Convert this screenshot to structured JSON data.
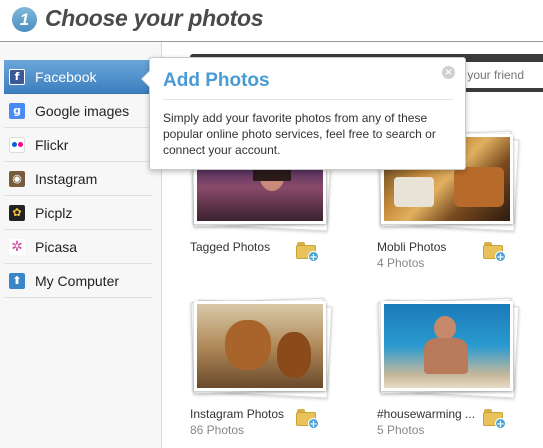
{
  "header": {
    "step_number": "1",
    "title": "Choose your photos"
  },
  "sidebar": {
    "items": [
      {
        "label": "Facebook",
        "icon": "facebook-icon",
        "color": "#3b5998",
        "glyph": "f",
        "active": true
      },
      {
        "label": "Google images",
        "icon": "google-icon",
        "color": "#4a8af4",
        "glyph": "g",
        "active": false
      },
      {
        "label": "Flickr",
        "icon": "flickr-icon",
        "color": "#ffffff",
        "glyph": "••",
        "active": false
      },
      {
        "label": "Instagram",
        "icon": "instagram-icon",
        "color": "#7a5a3e",
        "glyph": "◉",
        "active": false
      },
      {
        "label": "Picplz",
        "icon": "picplz-icon",
        "color": "#222222",
        "glyph": "✿",
        "active": false
      },
      {
        "label": "Picasa",
        "icon": "picasa-icon",
        "color": "#ffffff",
        "glyph": "✲",
        "active": false
      },
      {
        "label": "My Computer",
        "icon": "upload-icon",
        "color": "#3a86c8",
        "glyph": "⬆",
        "active": false
      }
    ]
  },
  "search": {
    "placeholder": "m your friend"
  },
  "popover": {
    "title": "Add Photos",
    "body": "Simply add your favorite photos from any of these popular online photo services, feel free to search or connect your account.",
    "close_glyph": "×"
  },
  "albums": [
    {
      "name": "Tagged Photos",
      "count": ""
    },
    {
      "name": "Mobli Photos",
      "count": "4 Photos"
    },
    {
      "name": "Instagram Photos",
      "count": "86 Photos"
    },
    {
      "name": "#housewarming ...",
      "count": "5 Photos"
    }
  ],
  "colors": {
    "accent": "#4a9bd4",
    "active_item": "#4a8fcc",
    "folder": "#e8c25a"
  }
}
